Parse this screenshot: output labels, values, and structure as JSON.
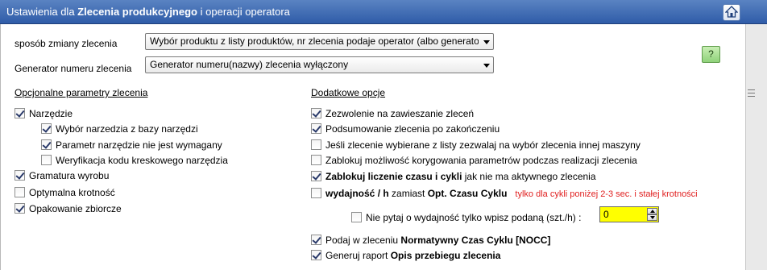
{
  "header": {
    "title_prefix": "Ustawienia dla",
    "title_bold": "Zlecenia produkcyjnego",
    "title_suffix": "i operacji operatora",
    "home_icon": "home-icon"
  },
  "settings": {
    "change_mode_label": "sposób zmiany zlecenia",
    "change_mode_value": "Wybór produktu z listy produktów, nr zlecenia podaje operator (albo generator)",
    "generator_label": "Generator numeru zlecenia",
    "generator_value": "Generator numeru(nazwy) zlecenia wyłączony",
    "help_label": "?"
  },
  "optional": {
    "heading": "Opcjonalne parametry zlecenia",
    "items": [
      {
        "label": "Narzędzie",
        "checked": true
      },
      {
        "label": "Wybór narzedzia z bazy narzędzi",
        "checked": true
      },
      {
        "label": "Parametr narzędzie nie jest wymagany",
        "checked": true
      },
      {
        "label": "Weryfikacja kodu kreskowego narzędzia",
        "checked": false
      },
      {
        "label": "Gramatura wyrobu",
        "checked": true
      },
      {
        "label": "Optymalna krotność",
        "checked": false
      },
      {
        "label": "Opakowanie zbiorcze",
        "checked": true
      }
    ]
  },
  "additional": {
    "heading": "Dodatkowe opcje",
    "items": [
      {
        "label": "Zezwolenie na zawieszanie zleceń",
        "checked": true
      },
      {
        "label": "Podsumowanie zlecenia po zakończeniu",
        "checked": true
      },
      {
        "label": "Jeśli zlecenie wybierane z listy zezwalaj na wybór zlecenia innej maszyny",
        "checked": false
      },
      {
        "label": "Zablokuj możliwość korygowania parametrów podczas realizacji zlecenia",
        "checked": false
      },
      {
        "label_bold": "Zablokuj liczenie czasu i cykli",
        "label_rest": "jak nie ma aktywnego zlecenia",
        "checked": true
      },
      {
        "label_bold1": "wydajność / h",
        "label_mid": "zamiast",
        "label_bold2": "Opt. Czasu Cyklu",
        "note": "tylko dla cykli  poniżej 2-3 sec. i stałej krotności",
        "checked": false
      },
      {
        "label": "Nie pytaj o wydajność tylko wpisz podaną (szt./h) :",
        "checked": false,
        "value": "0"
      },
      {
        "label_prefix": "Podaj w zleceniu",
        "label_bold": "Normatywny Czas Cyklu [NOCC]",
        "checked": true
      },
      {
        "label_prefix": "Generuj raport",
        "label_bold": "Opis przebiegu zlecenia",
        "checked": true
      }
    ]
  }
}
